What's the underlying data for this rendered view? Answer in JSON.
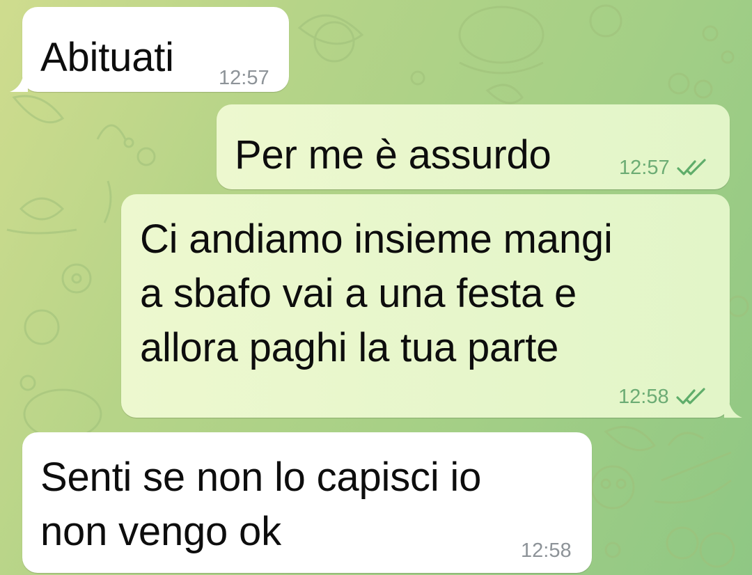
{
  "colors": {
    "incoming_bubble": "#ffffff",
    "outgoing_bubble": "#e4f6cb",
    "outgoing_meta": "#5fad6a",
    "incoming_meta": "#8d9398",
    "background": "#b6d488"
  },
  "messages": [
    {
      "direction": "incoming",
      "text": "Abituati",
      "time": "12:57"
    },
    {
      "direction": "outgoing",
      "text": "Per me è assurdo",
      "time": "12:57",
      "status_icon": "double-check-icon"
    },
    {
      "direction": "outgoing",
      "text": "Ci andiamo insieme mangi\na sbafo vai a una festa e\nallora paghi la tua parte",
      "time": "12:58",
      "status_icon": "double-check-icon"
    },
    {
      "direction": "incoming",
      "text": "Senti se non lo capisci io\nnon vengo ok",
      "time": "12:58"
    }
  ]
}
